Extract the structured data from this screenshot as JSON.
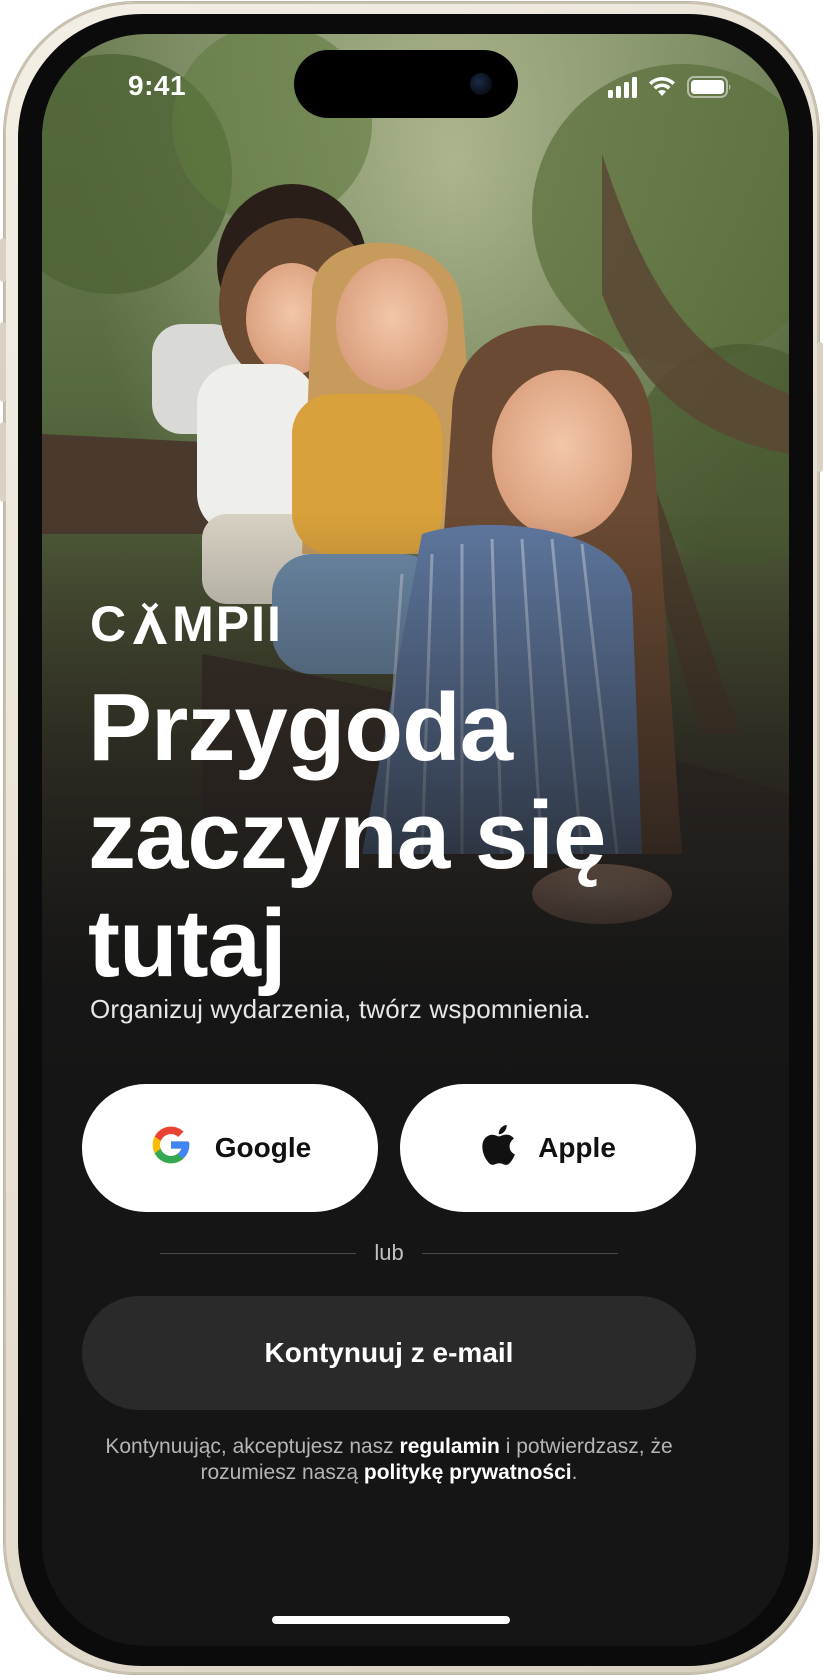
{
  "status_bar": {
    "time": "9:41",
    "icons": [
      "signal-icon",
      "wifi-icon",
      "battery-icon"
    ]
  },
  "hero": {
    "logo_text_left": "C",
    "logo_text_right": "MPII",
    "headline_line1": "Przygoda",
    "headline_line2": "zaczyna się",
    "headline_line3": "tutaj",
    "subtitle": "Organizuj wydarzenia, twórz wspomnienia."
  },
  "auth": {
    "google_label": "Google",
    "apple_label": "Apple",
    "divider_text": "lub",
    "email_label": "Kontynuuj z e-mail"
  },
  "terms": {
    "part1": "Kontynuując, akceptujesz nasz ",
    "link_terms": "regulamin",
    "part2": " i potwierdzasz, że rozumiesz naszą ",
    "link_privacy": "politykę prywatności",
    "part3": "."
  },
  "colors": {
    "background": "#151515",
    "button_light": "#ffffff",
    "button_dark": "#2a2a2a",
    "google_blue": "#4285F4",
    "google_red": "#EA4335",
    "google_yellow": "#FBBC05",
    "google_green": "#34A853"
  }
}
